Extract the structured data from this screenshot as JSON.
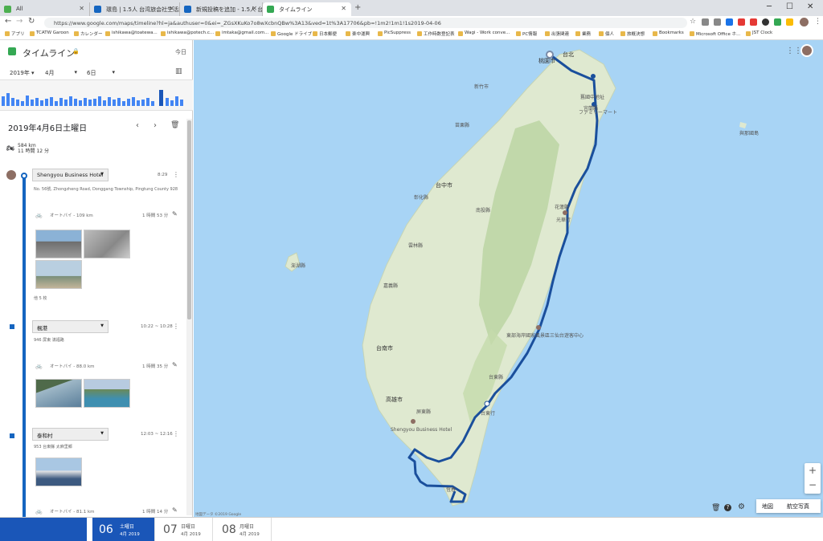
{
  "tabs": [
    {
      "label": "All",
      "color": "#4caf50"
    },
    {
      "label": "環島 | 1.5人 台湾旅会社生活記",
      "color": "#1565c0"
    },
    {
      "label": "新規投稿を追加 - 1.5人 台湾生活",
      "color": "#1565c0"
    },
    {
      "label": "タイムライン",
      "color": "#34a853"
    }
  ],
  "browser": {
    "url": "https://www.google.com/maps/timeline?hl=ja&authuser=0&ei=_ZGsXKuKo7o8wXcbnQBw%3A13&ved=1t%3A17706&pb=!1m2!1m1!1s2019-04-06"
  },
  "bookmarks": [
    "アプリ",
    "TCATW Garoon",
    "カレンダー",
    "ishikawa@toatewa...",
    "ishikawa@potech.c...",
    "imtaka@gmail.com...",
    "Google ドライブ",
    "日本郵便",
    "楽中運興",
    "PicSuppress",
    "工作時数登記表",
    "Wagi - Work conve...",
    "PC情報",
    "出張関連",
    "業務",
    "個人",
    "旅概決想",
    "Bookmarks",
    "Microsoft Office ホ...",
    "JST Clock"
  ],
  "panel": {
    "title": "タイムライン",
    "today": "今日",
    "year": "2019年",
    "month": "4月",
    "day": "6日",
    "date_title": "2019年4月6日土曜日",
    "distance": "584 km",
    "duration": "11 時間 12 分",
    "places": [
      {
        "name": "Shengyou Business Hotel",
        "time": "8:29",
        "address": "No. 56號, Zhongzheng Road, Donggang Township, Pingtung County 928",
        "mode": "オートバイ - 109 km",
        "dur": "1 時間 53 分",
        "photos": "他 5 枚"
      },
      {
        "name": "楓港",
        "time": "10:22 ~ 10:28",
        "address": "946 屏東 滿福路",
        "mode": "オートバイ - 88.0 km",
        "dur": "1 時間 35 分"
      },
      {
        "name": "泰和村",
        "time": "12:03 ~ 12:16",
        "address": "953 台東縣 太麻里鄉",
        "mode": "オートバイ - 81.1 km",
        "dur": "1 時間 14 分"
      }
    ]
  },
  "days": [
    {
      "num": "06",
      "name": "土曜日",
      "month": "4月 2019",
      "active": true
    },
    {
      "num": "07",
      "name": "日曜日",
      "month": "4月 2019",
      "active": false
    },
    {
      "num": "08",
      "name": "月曜日",
      "month": "4月 2019",
      "active": false
    }
  ],
  "map": {
    "labels": [
      {
        "t": "台北",
        "big": true
      },
      {
        "t": "桃園市"
      },
      {
        "t": "新竹市"
      },
      {
        "t": "苗栗縣"
      },
      {
        "t": "台中市",
        "big": true
      },
      {
        "t": "彰化縣"
      },
      {
        "t": "南投縣"
      },
      {
        "t": "雲林縣"
      },
      {
        "t": "澎湖縣"
      },
      {
        "t": "嘉義縣"
      },
      {
        "t": "台南市",
        "big": true
      },
      {
        "t": "高雄市",
        "big": true
      },
      {
        "t": "屏東縣"
      },
      {
        "t": "台東縣"
      },
      {
        "t": "花蓮縣"
      },
      {
        "t": "宜蘭縣"
      },
      {
        "t": "恆春"
      },
      {
        "t": "與那國島"
      },
      {
        "t": "東部海岸國家風景區三仙台遊客中心"
      },
      {
        "t": "Shengyou Business Hotel"
      },
      {
        "t": "台東行"
      },
      {
        "t": "光華行"
      },
      {
        "t": "ファミリーマート"
      },
      {
        "t": "舊國中地址"
      },
      {
        "t": "地図データ ©2019 Google"
      }
    ],
    "type_map": "地図",
    "type_sat": "航空写真"
  }
}
